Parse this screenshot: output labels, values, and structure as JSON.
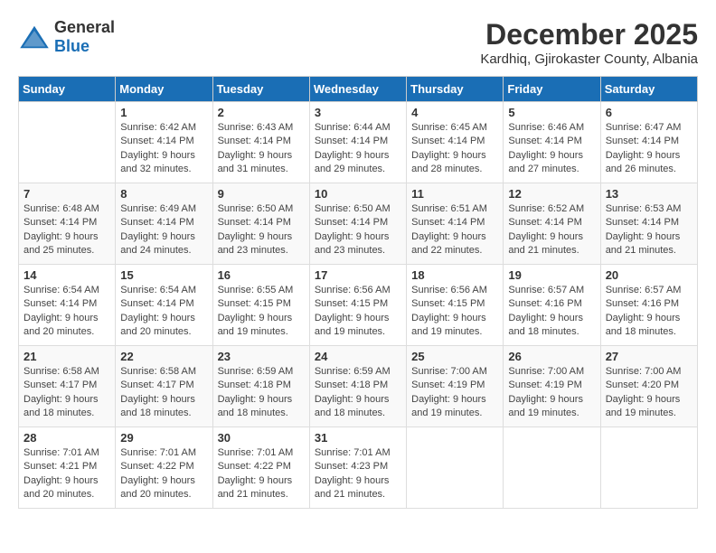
{
  "header": {
    "logo_general": "General",
    "logo_blue": "Blue",
    "month_title": "December 2025",
    "location": "Kardhiq, Gjirokaster County, Albania"
  },
  "days_of_week": [
    "Sunday",
    "Monday",
    "Tuesday",
    "Wednesday",
    "Thursday",
    "Friday",
    "Saturday"
  ],
  "weeks": [
    [
      {
        "day": "",
        "info": ""
      },
      {
        "day": "1",
        "info": "Sunrise: 6:42 AM\nSunset: 4:14 PM\nDaylight: 9 hours\nand 32 minutes."
      },
      {
        "day": "2",
        "info": "Sunrise: 6:43 AM\nSunset: 4:14 PM\nDaylight: 9 hours\nand 31 minutes."
      },
      {
        "day": "3",
        "info": "Sunrise: 6:44 AM\nSunset: 4:14 PM\nDaylight: 9 hours\nand 29 minutes."
      },
      {
        "day": "4",
        "info": "Sunrise: 6:45 AM\nSunset: 4:14 PM\nDaylight: 9 hours\nand 28 minutes."
      },
      {
        "day": "5",
        "info": "Sunrise: 6:46 AM\nSunset: 4:14 PM\nDaylight: 9 hours\nand 27 minutes."
      },
      {
        "day": "6",
        "info": "Sunrise: 6:47 AM\nSunset: 4:14 PM\nDaylight: 9 hours\nand 26 minutes."
      }
    ],
    [
      {
        "day": "7",
        "info": "Sunrise: 6:48 AM\nSunset: 4:14 PM\nDaylight: 9 hours\nand 25 minutes."
      },
      {
        "day": "8",
        "info": "Sunrise: 6:49 AM\nSunset: 4:14 PM\nDaylight: 9 hours\nand 24 minutes."
      },
      {
        "day": "9",
        "info": "Sunrise: 6:50 AM\nSunset: 4:14 PM\nDaylight: 9 hours\nand 23 minutes."
      },
      {
        "day": "10",
        "info": "Sunrise: 6:50 AM\nSunset: 4:14 PM\nDaylight: 9 hours\nand 23 minutes."
      },
      {
        "day": "11",
        "info": "Sunrise: 6:51 AM\nSunset: 4:14 PM\nDaylight: 9 hours\nand 22 minutes."
      },
      {
        "day": "12",
        "info": "Sunrise: 6:52 AM\nSunset: 4:14 PM\nDaylight: 9 hours\nand 21 minutes."
      },
      {
        "day": "13",
        "info": "Sunrise: 6:53 AM\nSunset: 4:14 PM\nDaylight: 9 hours\nand 21 minutes."
      }
    ],
    [
      {
        "day": "14",
        "info": "Sunrise: 6:54 AM\nSunset: 4:14 PM\nDaylight: 9 hours\nand 20 minutes."
      },
      {
        "day": "15",
        "info": "Sunrise: 6:54 AM\nSunset: 4:14 PM\nDaylight: 9 hours\nand 20 minutes."
      },
      {
        "day": "16",
        "info": "Sunrise: 6:55 AM\nSunset: 4:15 PM\nDaylight: 9 hours\nand 19 minutes."
      },
      {
        "day": "17",
        "info": "Sunrise: 6:56 AM\nSunset: 4:15 PM\nDaylight: 9 hours\nand 19 minutes."
      },
      {
        "day": "18",
        "info": "Sunrise: 6:56 AM\nSunset: 4:15 PM\nDaylight: 9 hours\nand 19 minutes."
      },
      {
        "day": "19",
        "info": "Sunrise: 6:57 AM\nSunset: 4:16 PM\nDaylight: 9 hours\nand 18 minutes."
      },
      {
        "day": "20",
        "info": "Sunrise: 6:57 AM\nSunset: 4:16 PM\nDaylight: 9 hours\nand 18 minutes."
      }
    ],
    [
      {
        "day": "21",
        "info": "Sunrise: 6:58 AM\nSunset: 4:17 PM\nDaylight: 9 hours\nand 18 minutes."
      },
      {
        "day": "22",
        "info": "Sunrise: 6:58 AM\nSunset: 4:17 PM\nDaylight: 9 hours\nand 18 minutes."
      },
      {
        "day": "23",
        "info": "Sunrise: 6:59 AM\nSunset: 4:18 PM\nDaylight: 9 hours\nand 18 minutes."
      },
      {
        "day": "24",
        "info": "Sunrise: 6:59 AM\nSunset: 4:18 PM\nDaylight: 9 hours\nand 18 minutes."
      },
      {
        "day": "25",
        "info": "Sunrise: 7:00 AM\nSunset: 4:19 PM\nDaylight: 9 hours\nand 19 minutes."
      },
      {
        "day": "26",
        "info": "Sunrise: 7:00 AM\nSunset: 4:19 PM\nDaylight: 9 hours\nand 19 minutes."
      },
      {
        "day": "27",
        "info": "Sunrise: 7:00 AM\nSunset: 4:20 PM\nDaylight: 9 hours\nand 19 minutes."
      }
    ],
    [
      {
        "day": "28",
        "info": "Sunrise: 7:01 AM\nSunset: 4:21 PM\nDaylight: 9 hours\nand 20 minutes."
      },
      {
        "day": "29",
        "info": "Sunrise: 7:01 AM\nSunset: 4:22 PM\nDaylight: 9 hours\nand 20 minutes."
      },
      {
        "day": "30",
        "info": "Sunrise: 7:01 AM\nSunset: 4:22 PM\nDaylight: 9 hours\nand 21 minutes."
      },
      {
        "day": "31",
        "info": "Sunrise: 7:01 AM\nSunset: 4:23 PM\nDaylight: 9 hours\nand 21 minutes."
      },
      {
        "day": "",
        "info": ""
      },
      {
        "day": "",
        "info": ""
      },
      {
        "day": "",
        "info": ""
      }
    ]
  ]
}
